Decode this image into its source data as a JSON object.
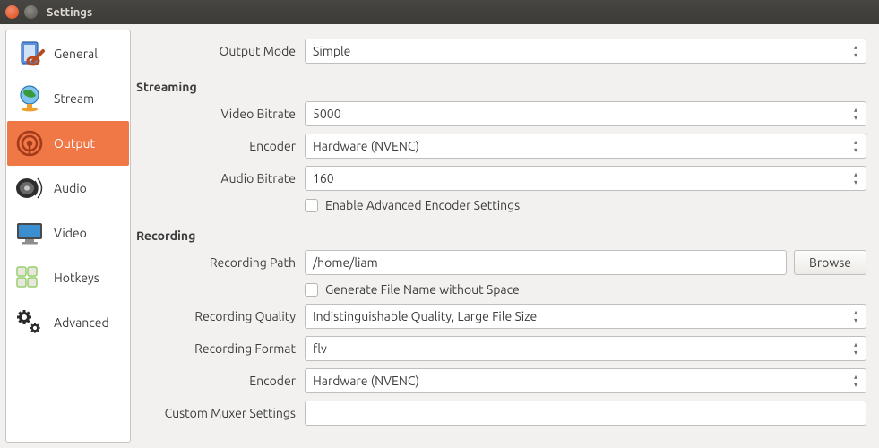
{
  "window": {
    "title": "Settings"
  },
  "sidebar": {
    "items": [
      {
        "label": "General"
      },
      {
        "label": "Stream"
      },
      {
        "label": "Output"
      },
      {
        "label": "Audio"
      },
      {
        "label": "Video"
      },
      {
        "label": "Hotkeys"
      },
      {
        "label": "Advanced"
      }
    ]
  },
  "output": {
    "mode_label": "Output Mode",
    "mode_value": "Simple"
  },
  "streaming": {
    "section_label": "Streaming",
    "video_bitrate_label": "Video Bitrate",
    "video_bitrate_value": "5000",
    "encoder_label": "Encoder",
    "encoder_value": "Hardware (NVENC)",
    "audio_bitrate_label": "Audio Bitrate",
    "audio_bitrate_value": "160",
    "advanced_checkbox_label": "Enable Advanced Encoder Settings"
  },
  "recording": {
    "section_label": "Recording",
    "path_label": "Recording Path",
    "path_value": "/home/liam",
    "browse_label": "Browse",
    "no_space_checkbox_label": "Generate File Name without Space",
    "quality_label": "Recording Quality",
    "quality_value": "Indistinguishable Quality, Large File Size",
    "format_label": "Recording Format",
    "format_value": "flv",
    "encoder_label": "Encoder",
    "encoder_value": "Hardware (NVENC)",
    "muxer_label": "Custom Muxer Settings",
    "muxer_value": ""
  }
}
